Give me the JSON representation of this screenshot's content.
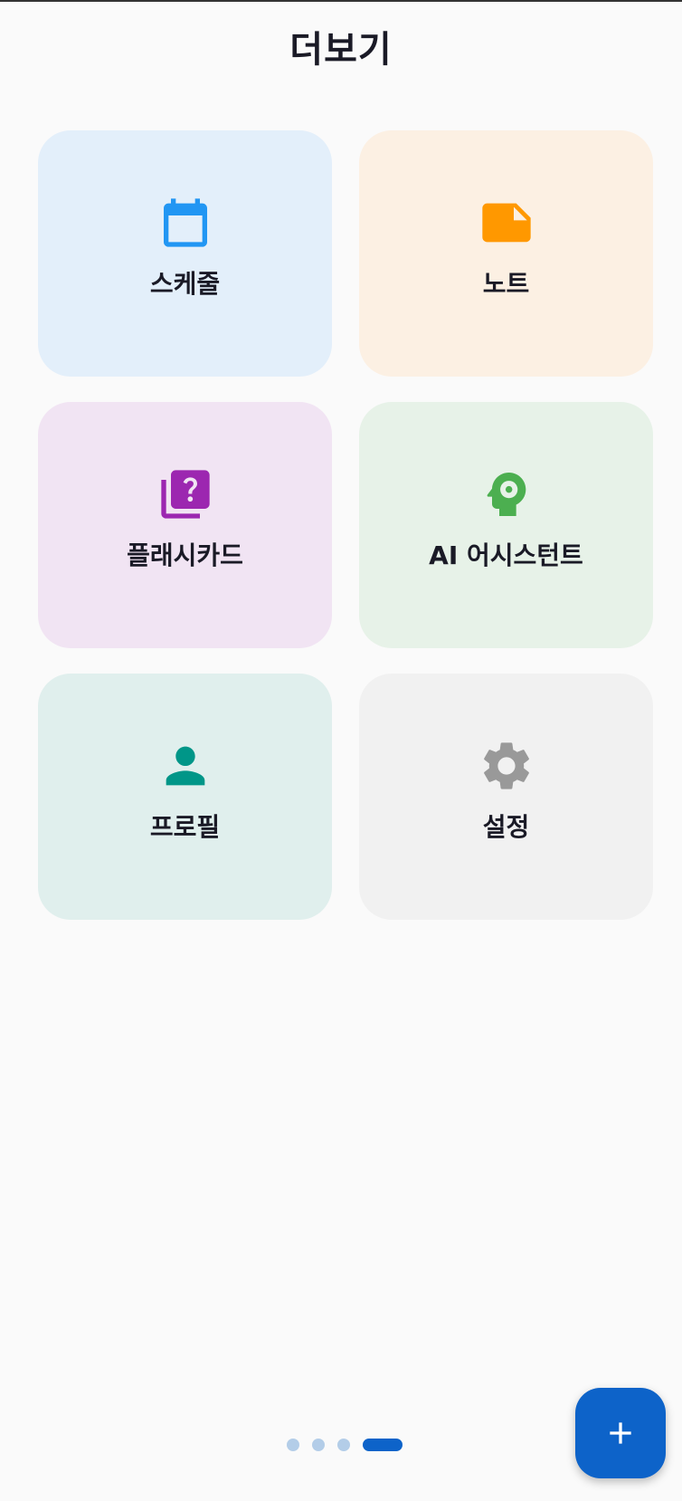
{
  "header": {
    "title": "더보기"
  },
  "tiles": [
    {
      "id": "schedule",
      "label": "스케줄",
      "icon": "calendar-icon",
      "bg": "#e3effa",
      "color": "#2196f3"
    },
    {
      "id": "note",
      "label": "노트",
      "icon": "note-icon",
      "bg": "#fcf0e3",
      "color": "#ff9800"
    },
    {
      "id": "flashcard",
      "label": "플래시카드",
      "icon": "quiz-icon",
      "bg": "#f1e4f3",
      "color": "#9c27b0"
    },
    {
      "id": "ai-assistant",
      "label": "AI 어시스턴트",
      "icon": "psychology-icon",
      "bg": "#e7f2e8",
      "color": "#4caf50"
    },
    {
      "id": "profile",
      "label": "프로필",
      "icon": "person-icon",
      "bg": "#e0efed",
      "color": "#009688"
    },
    {
      "id": "settings",
      "label": "설정",
      "icon": "gear-icon",
      "bg": "#f1f1f1",
      "color": "#999999"
    }
  ],
  "pager": {
    "total": 4,
    "active": 4
  },
  "fab": {
    "icon": "plus-icon",
    "color": "#0d63c9"
  }
}
